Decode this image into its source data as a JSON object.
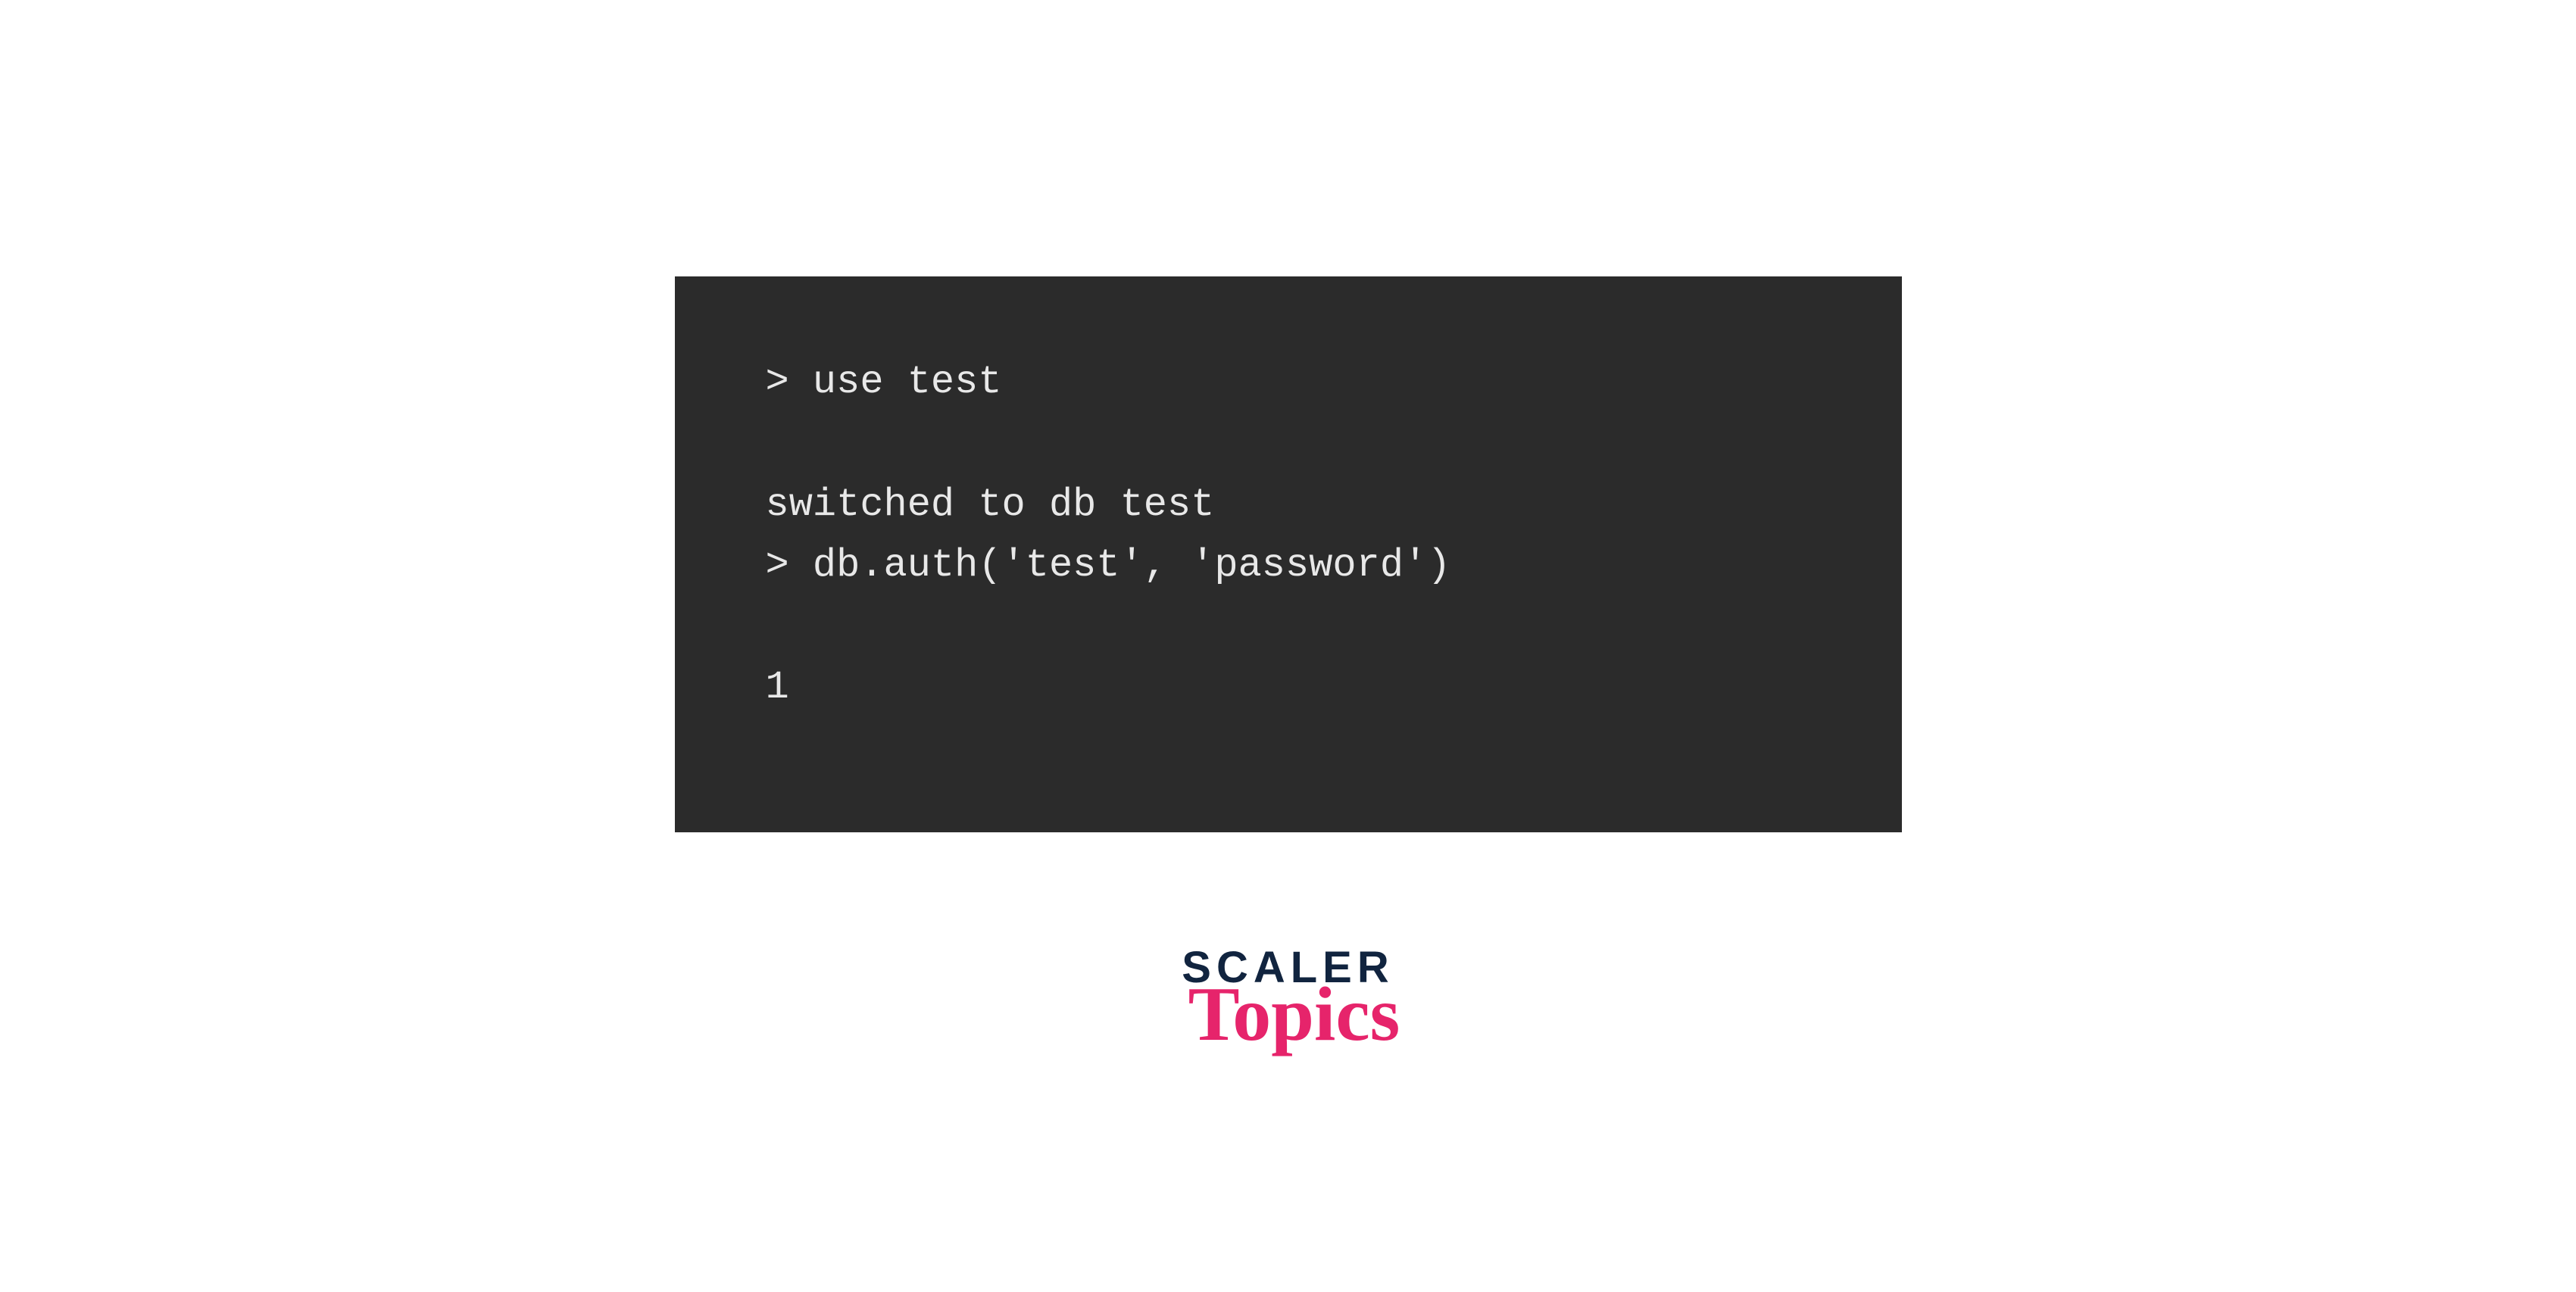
{
  "terminal": {
    "lines": [
      "> use test",
      "",
      "switched to db test",
      "> db.auth('test', 'password')",
      "",
      "1"
    ]
  },
  "logo": {
    "line1": "SCALER",
    "line2": "Topics"
  },
  "colors": {
    "terminal_bg": "#2b2b2b",
    "terminal_fg": "#e8e8e8",
    "logo_dark": "#11243f",
    "logo_accent": "#e6246b"
  }
}
